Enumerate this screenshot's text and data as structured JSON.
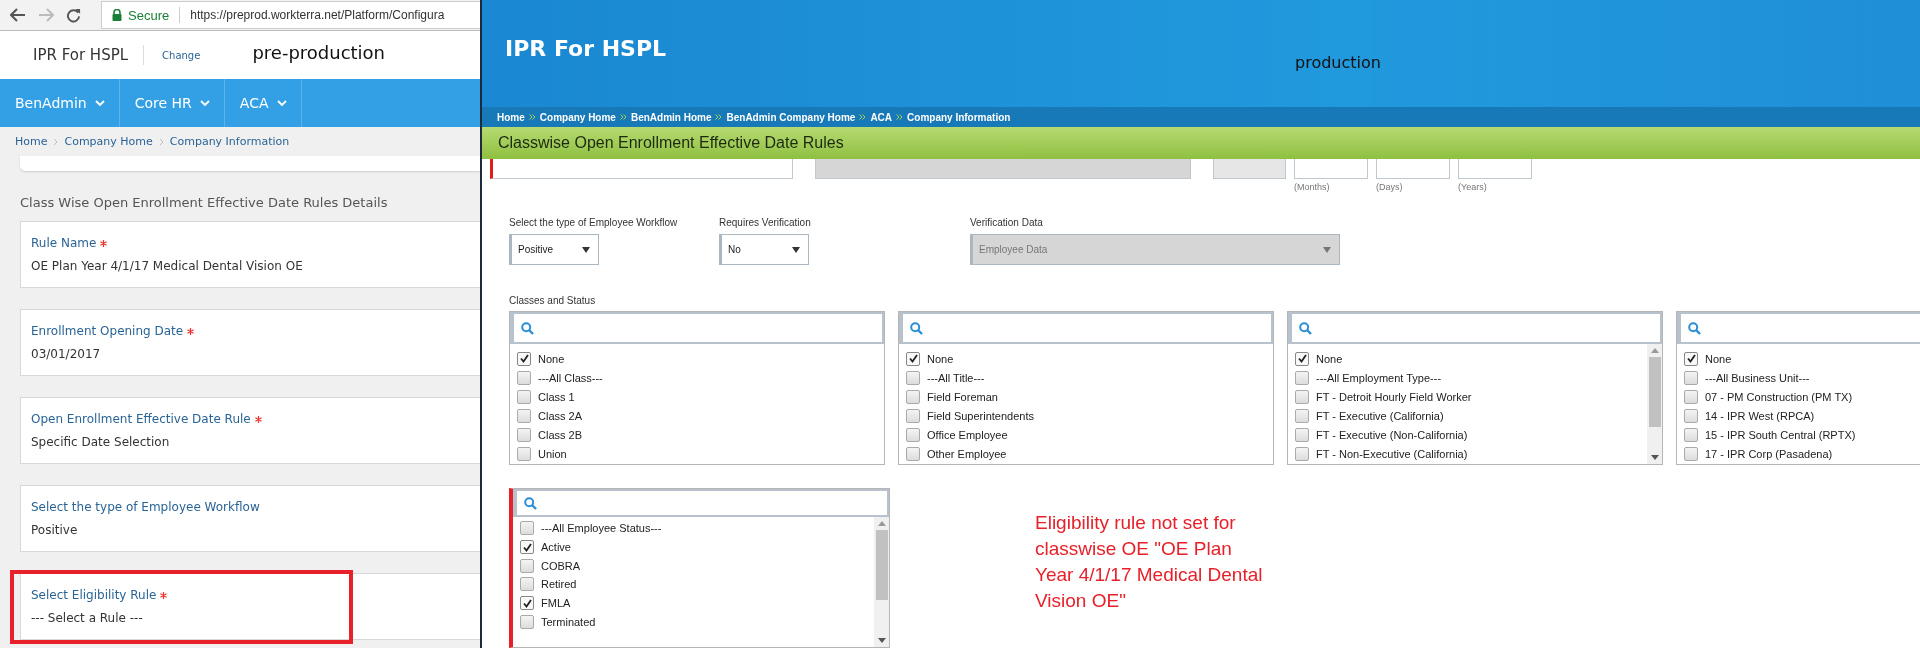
{
  "preprod": {
    "browser": {
      "secure_label": "Secure",
      "url": "https://preprod.workterra.net/Platform/Configura"
    },
    "header": {
      "company": "IPR For HSPL",
      "change_link": "Change",
      "environment_note": "pre-production"
    },
    "nav": [
      {
        "label": "BenAdmin"
      },
      {
        "label": "Core HR"
      },
      {
        "label": "ACA"
      }
    ],
    "breadcrumb": [
      "Home",
      "Company Home",
      "Company Information"
    ],
    "section_title": "Class Wise Open Enrollment Effective Date Rules Details",
    "fields": [
      {
        "label": "Rule Name",
        "required": true,
        "value": "OE Plan Year 4/1/17 Medical Dental Vision OE",
        "highlighted": false
      },
      {
        "label": "Enrollment Opening Date",
        "required": true,
        "value": "03/01/2017",
        "highlighted": false
      },
      {
        "label": "Open Enrollment Effective Date Rule",
        "required": true,
        "value": "Specific Date Selection",
        "highlighted": false
      },
      {
        "label": "Select the type of Employee Workflow",
        "required": false,
        "value": "Positive",
        "highlighted": false
      },
      {
        "label": "Select Eligibility Rule",
        "required": true,
        "value": "--- Select a Rule ---",
        "highlighted": true
      }
    ]
  },
  "prod": {
    "header": {
      "company": "IPR For HSPL",
      "environment_note": "production"
    },
    "breadcrumb": [
      "Home",
      "Company Home",
      "BenAdmin Home",
      "BenAdmin Company Home",
      "ACA",
      "Company Information"
    ],
    "page_title": "Classwise Open Enrollment Effective Date Rules",
    "period_labels": [
      "(Months)",
      "(Days)",
      "(Years)"
    ],
    "selects": [
      {
        "label": "Select the type of Employee Workflow",
        "value": "Positive",
        "disabled": false
      },
      {
        "label": "Requires Verification",
        "value": "No",
        "disabled": false
      },
      {
        "label": "Verification Data",
        "value": "Employee Data",
        "disabled": true
      }
    ],
    "classes_label": "Classes and Status",
    "lists": [
      {
        "scrollable": false,
        "items": [
          {
            "label": "None",
            "checked": true
          },
          {
            "label": "---All Class---",
            "checked": false
          },
          {
            "label": "Class 1",
            "checked": false
          },
          {
            "label": "Class 2A",
            "checked": false
          },
          {
            "label": "Class 2B",
            "checked": false
          },
          {
            "label": "Union",
            "checked": false
          }
        ]
      },
      {
        "scrollable": false,
        "items": [
          {
            "label": "None",
            "checked": true
          },
          {
            "label": "---All Title---",
            "checked": false
          },
          {
            "label": "Field Foreman",
            "checked": false
          },
          {
            "label": "Field Superintendents",
            "checked": false
          },
          {
            "label": "Office Employee",
            "checked": false
          },
          {
            "label": "Other Employee",
            "checked": false
          }
        ]
      },
      {
        "scrollable": true,
        "items": [
          {
            "label": "None",
            "checked": true
          },
          {
            "label": "---All Employment Type---",
            "checked": false
          },
          {
            "label": "FT - Detroit Hourly Field Worker",
            "checked": false
          },
          {
            "label": "FT - Executive (California)",
            "checked": false
          },
          {
            "label": "FT - Executive (Non-California)",
            "checked": false
          },
          {
            "label": "FT - Non-Executive (California)",
            "checked": false
          }
        ]
      },
      {
        "scrollable": false,
        "items": [
          {
            "label": "None",
            "checked": true
          },
          {
            "label": "---All Business Unit---",
            "checked": false
          },
          {
            "label": "07 - PM Construction (PM TX)",
            "checked": false
          },
          {
            "label": "14 - IPR West (RPCA)",
            "checked": false
          },
          {
            "label": "15 - IPR South Central (RPTX)",
            "checked": false
          },
          {
            "label": "17 - IPR Corp (Pasadena)",
            "checked": false
          }
        ]
      }
    ],
    "status_list": {
      "scrollable": true,
      "invalid": true,
      "items": [
        {
          "label": "---All Employee Status---",
          "checked": false
        },
        {
          "label": "Active",
          "checked": true
        },
        {
          "label": "COBRA",
          "checked": false
        },
        {
          "label": "Retired",
          "checked": false
        },
        {
          "label": "FMLA",
          "checked": true
        },
        {
          "label": "Terminated",
          "checked": false
        }
      ]
    }
  },
  "annotation": "Eligibility rule not set for classwise OE \"OE Plan Year 4/1/17 Medical Dental Vision OE\""
}
